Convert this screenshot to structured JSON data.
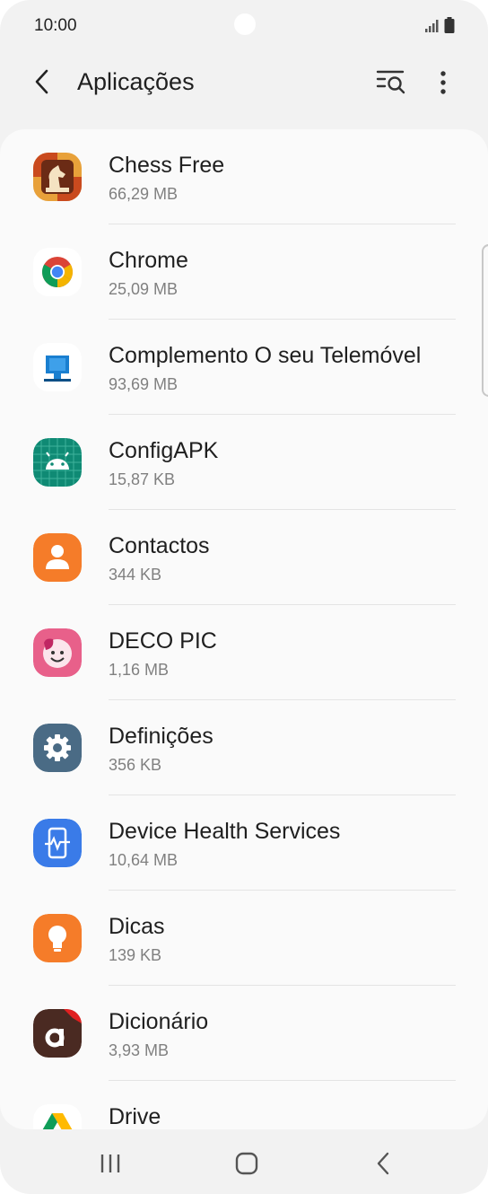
{
  "status": {
    "time": "10:00"
  },
  "appbar": {
    "title": "Aplicações",
    "search_icon": "search-list-icon",
    "more_icon": "more-vert-icon",
    "back_icon": "chevron-left-icon"
  },
  "apps": [
    {
      "name": "Chess Free",
      "size": "66,29 MB",
      "icon": "chess-free-icon"
    },
    {
      "name": "Chrome",
      "size": "25,09 MB",
      "icon": "chrome-icon"
    },
    {
      "name": "Complemento O seu Telemóvel",
      "size": "93,69 MB",
      "icon": "complemento-icon"
    },
    {
      "name": "ConfigAPK",
      "size": "15,87 KB",
      "icon": "android-icon"
    },
    {
      "name": "Contactos",
      "size": "344 KB",
      "icon": "contacts-icon"
    },
    {
      "name": "DECO PIC",
      "size": "1,16 MB",
      "icon": "deco-pic-icon"
    },
    {
      "name": "Definições",
      "size": "356 KB",
      "icon": "settings-gear-icon"
    },
    {
      "name": "Device Health Services",
      "size": "10,64 MB",
      "icon": "device-health-icon"
    },
    {
      "name": "Dicas",
      "size": "139 KB",
      "icon": "tips-bulb-icon"
    },
    {
      "name": "Dicionário",
      "size": "3,93 MB",
      "icon": "dictionary-icon"
    },
    {
      "name": "Drive",
      "size": "",
      "icon": "drive-icon"
    }
  ],
  "colors": {
    "background": "#f2f2f2",
    "list_background": "#fafafa",
    "text_primary": "#1f1f1f",
    "text_secondary": "#808080"
  }
}
